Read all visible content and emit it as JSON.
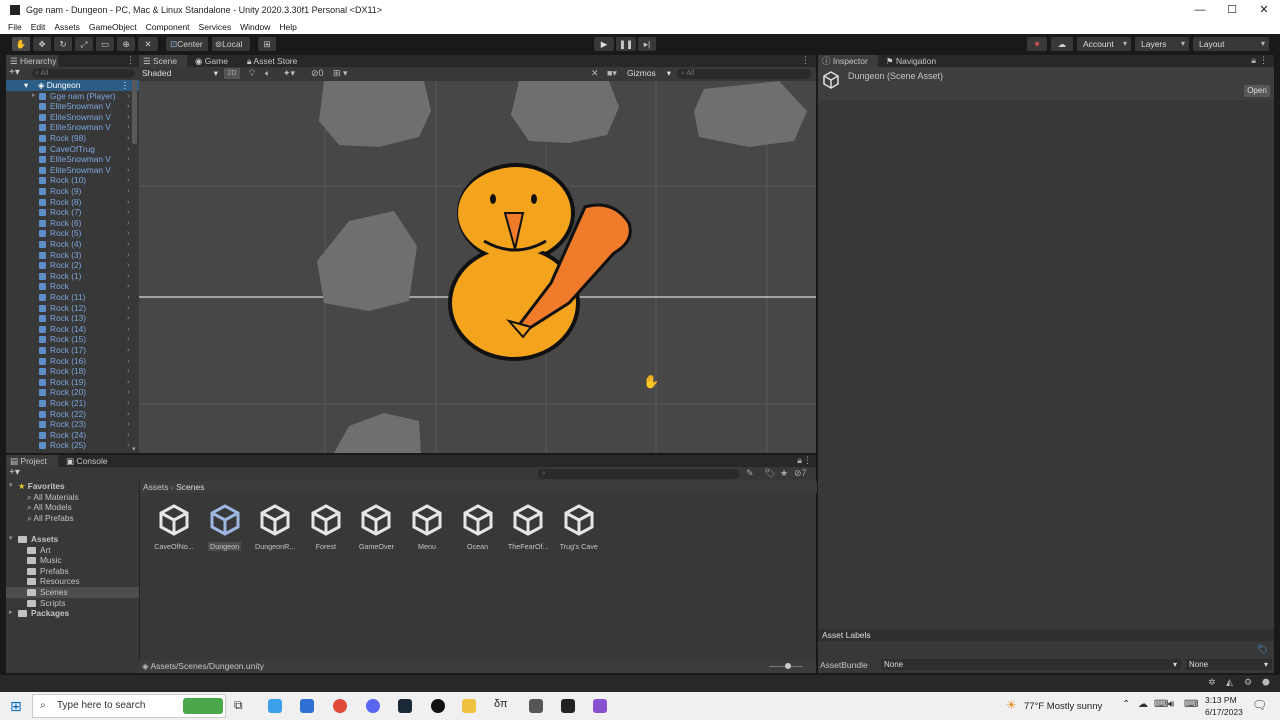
{
  "window": {
    "title": "Gge nam - Dungeon - PC, Mac & Linux Standalone - Unity 2020.3.30f1 Personal <DX11>",
    "controls": [
      "—",
      "☐",
      "✕"
    ]
  },
  "menu": [
    "File",
    "Edit",
    "Assets",
    "GameObject",
    "Component",
    "Services",
    "Window",
    "Help"
  ],
  "toolbar": {
    "pivot": "Center",
    "space": "Local",
    "account": "Account",
    "layers": "Layers",
    "layout": "Layout"
  },
  "hierarchy": {
    "tab": "Hierarchy",
    "search_placeholder": "All",
    "scene": "Dungeon",
    "items": [
      "Gge nam (Player)",
      "EliteSnowman V",
      "EliteSnowman V",
      "EliteSnowman V",
      "Rock (98)",
      "CaveOfTrug",
      "EliteSnowman V",
      "EliteSnowman V",
      "Rock (10)",
      "Rock (9)",
      "Rock (8)",
      "Rock (7)",
      "Rock (6)",
      "Rock (5)",
      "Rock (4)",
      "Rock (3)",
      "Rock (2)",
      "Rock (1)",
      "Rock",
      "Rock (11)",
      "Rock (12)",
      "Rock (13)",
      "Rock (14)",
      "Rock (15)",
      "Rock (17)",
      "Rock (16)",
      "Rock (18)",
      "Rock (19)",
      "Rock (20)",
      "Rock (21)",
      "Rock (22)",
      "Rock (23)",
      "Rock (24)",
      "Rock (25)"
    ]
  },
  "scene_view": {
    "tabs": [
      "Scene",
      "Game",
      "Asset Store"
    ],
    "shading": "Shaded",
    "mode_2d": "2D",
    "hidden_count": "0",
    "gizmos": "Gizmos",
    "search_placeholder": "All"
  },
  "inspector": {
    "tabs": [
      "Inspector",
      "Navigation"
    ],
    "title": "Dungeon (Scene Asset)",
    "open_button": "Open",
    "asset_labels": "Asset Labels",
    "asset_bundle_label": "AssetBundle",
    "asset_bundle_value": "None",
    "asset_variant_value": "None"
  },
  "project": {
    "tabs": [
      "Project",
      "Console"
    ],
    "favorites": {
      "label": "Favorites",
      "items": [
        "All Materials",
        "All Models",
        "All Prefabs"
      ]
    },
    "assets": {
      "label": "Assets",
      "items": [
        "Art",
        "Music",
        "Prefabs",
        "Resources",
        "Scenes",
        "Scripts"
      ]
    },
    "packages": "Packages",
    "breadcrumb": [
      "Assets",
      "Scenes"
    ],
    "files": [
      "CaveOfNo...",
      "Dungeon",
      "DungeonR...",
      "Forest",
      "GameOver",
      "Menu",
      "Ocean",
      "TheFearOf...",
      "Trug's Cave"
    ],
    "selected_file": "Dungeon",
    "status_path": "Assets/Scenes/Dungeon.unity",
    "hidden_count": "7"
  },
  "taskbar": {
    "search_placeholder": "Type here to search",
    "weather": "77°F  Mostly sunny",
    "time": "3:13 PM",
    "date": "6/17/2023"
  },
  "colors": {
    "background": "#191919",
    "panel": "#383838",
    "scene_bg": "#474747",
    "rock": "#6f6f6f",
    "snowman": "#f4a41c",
    "carrot": "#f07b2a",
    "hierarchy_text": "#7ca6de"
  }
}
